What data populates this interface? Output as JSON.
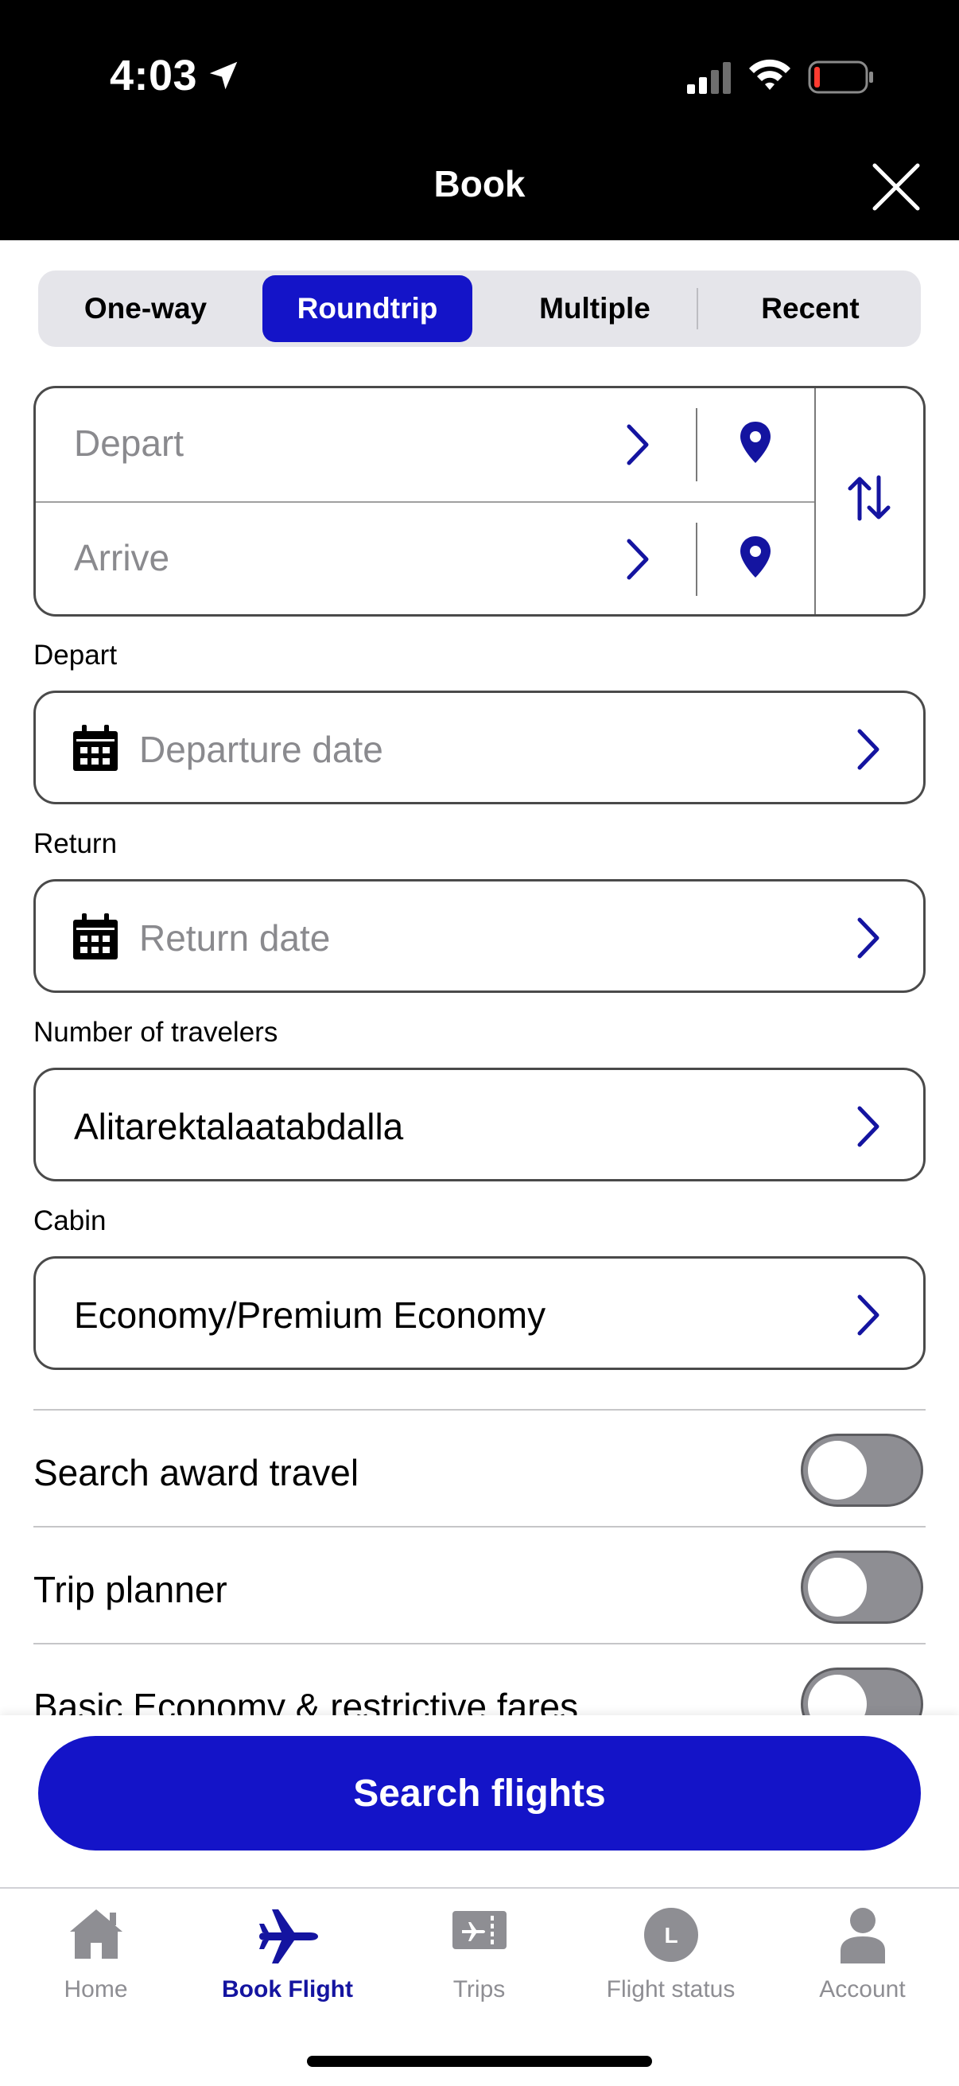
{
  "status_bar": {
    "time": "4:03"
  },
  "header": {
    "title": "Book"
  },
  "trip_types": [
    {
      "label": "One-way",
      "active": false
    },
    {
      "label": "Roundtrip",
      "active": true
    },
    {
      "label": "Multiple",
      "active": false
    },
    {
      "label": "Recent",
      "active": false
    }
  ],
  "airports": {
    "depart_placeholder": "Depart",
    "arrive_placeholder": "Arrive"
  },
  "dates": {
    "depart_label": "Depart",
    "depart_placeholder": "Departure date",
    "return_label": "Return",
    "return_placeholder": "Return date"
  },
  "travelers": {
    "label": "Number of travelers",
    "value": "Alitarektalaatabdalla"
  },
  "cabin": {
    "label": "Cabin",
    "value": "Economy/Premium Economy"
  },
  "toggles": [
    {
      "label": "Search award travel",
      "on": false
    },
    {
      "label": "Trip planner",
      "on": false
    },
    {
      "label": "Basic Economy & restrictive fares",
      "on": false
    }
  ],
  "search_button": "Search flights",
  "tabs": [
    {
      "label": "Home",
      "icon": "home-icon",
      "active": false
    },
    {
      "label": "Book Flight",
      "icon": "airplane-icon",
      "active": true
    },
    {
      "label": "Trips",
      "icon": "ticket-icon",
      "active": false
    },
    {
      "label": "Flight status",
      "icon": "clock-badge-icon",
      "active": false
    },
    {
      "label": "Account",
      "icon": "person-icon",
      "active": false
    }
  ],
  "tab_status_glyph": "L",
  "colors": {
    "accent": "#1414c8",
    "tab_active": "#1414a0",
    "header_bg": "#000000",
    "toggle_off": "#8e8e93"
  }
}
